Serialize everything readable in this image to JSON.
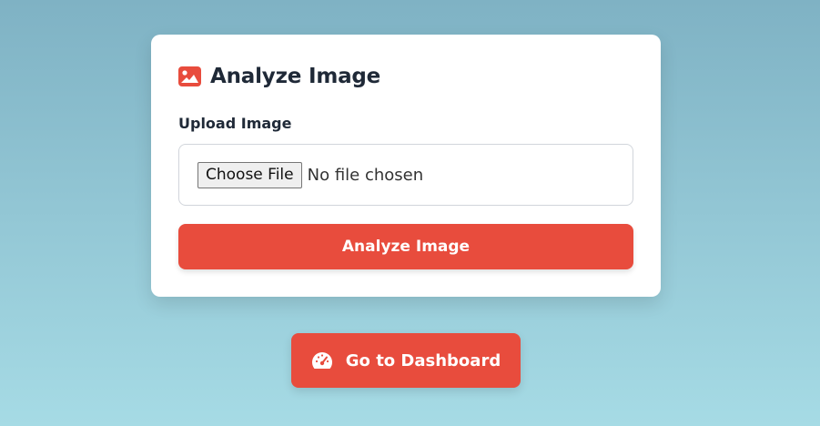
{
  "card": {
    "title": "Analyze Image",
    "title_icon": "image-icon",
    "upload_label": "Upload Image",
    "file_input": {
      "button_label": "Choose File",
      "status_text": "No file chosen"
    },
    "submit_label": "Analyze Image"
  },
  "dashboard_button": {
    "label": "Go to Dashboard",
    "icon": "tachometer-icon"
  },
  "colors": {
    "accent": "#e84c3d",
    "background_top": "#7fb2c4",
    "background_bottom": "#a6dbe5",
    "card": "#ffffff",
    "text": "#1f2937"
  }
}
